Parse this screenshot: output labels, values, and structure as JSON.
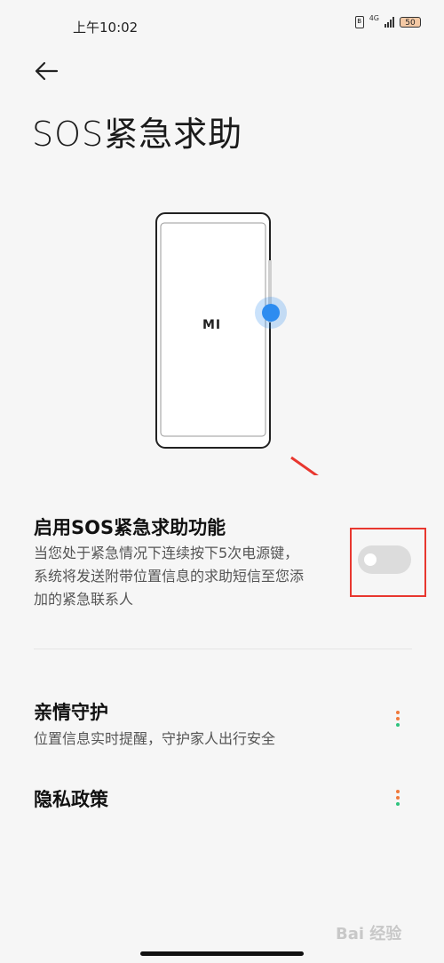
{
  "status_bar": {
    "time": "上午10:02",
    "network": "4G",
    "battery": "50"
  },
  "header": {
    "title": "SOS紧急求助"
  },
  "illustration": {
    "brand_mark": "MI",
    "accent_color": "#2d8cf0"
  },
  "sos_feature": {
    "title": "启用SOS紧急求助功能",
    "description": "当您处于紧急情况下连续按下5次电源键，\n系统将发送附带位置信息的求助短信至您添\n加的紧急联系人",
    "enabled": false,
    "highlight_color": "#e8372f"
  },
  "settings": [
    {
      "title": "亲情守护",
      "subtitle": "位置信息实时提醒，守护家人出行安全"
    },
    {
      "title": "隐私政策",
      "subtitle": ""
    }
  ],
  "watermark": "Bai 经验"
}
